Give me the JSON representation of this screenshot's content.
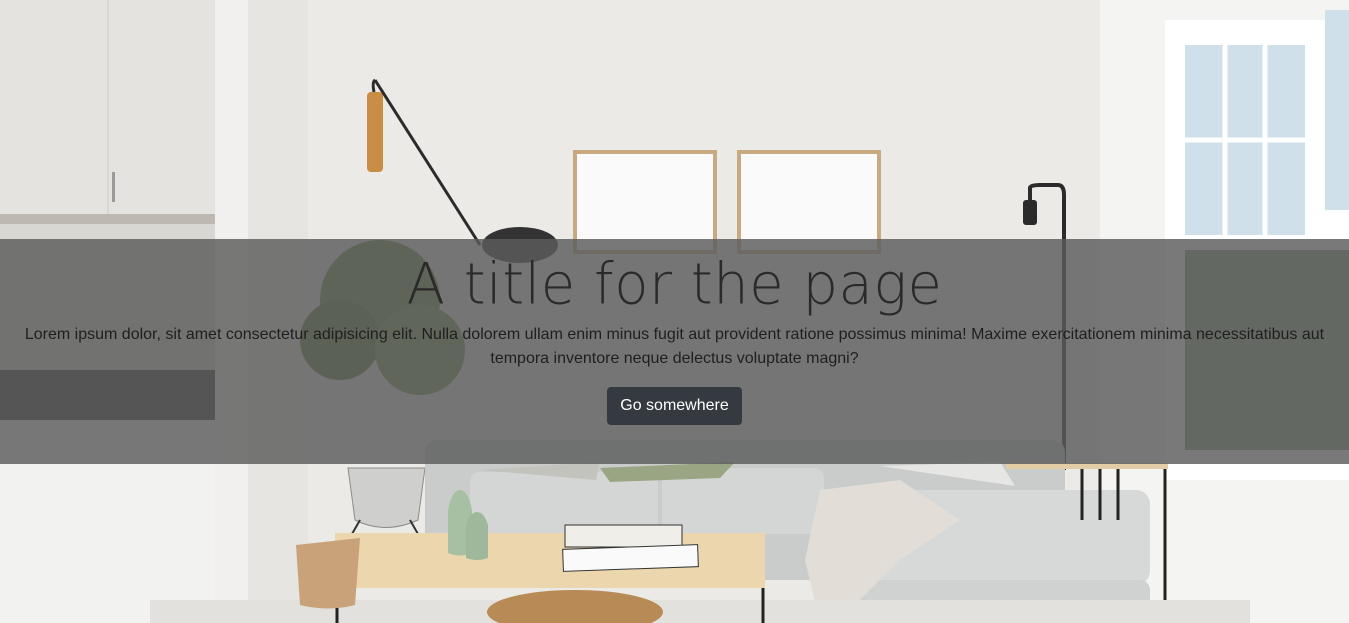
{
  "hero": {
    "title": "A title for the page",
    "text": "Lorem ipsum dolor, sit amet consectetur adipisicing elit. Nulla dolorem ullam enim minus fugit aut provident ratione possimus minima! Maxime exercitationem minima necessitatibus aut tempora inventore neque delectus voluptate magni?",
    "button_label": "Go somewhere"
  },
  "colors": {
    "overlay": "#5c5c5c",
    "button_bg": "#343a40",
    "button_text": "#ffffff",
    "title_text": "#2a2a2a"
  }
}
